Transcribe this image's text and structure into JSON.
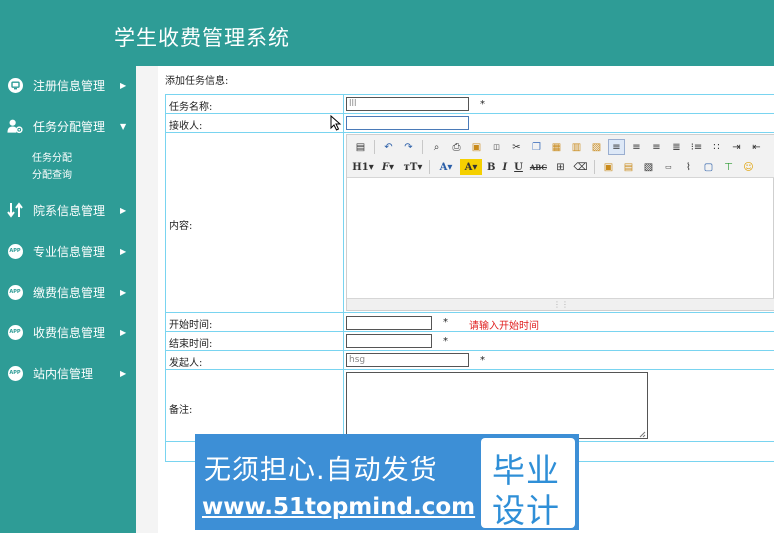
{
  "header": {
    "title": "学生收费管理系统"
  },
  "sidebar": {
    "items": [
      {
        "label": "注册信息管理",
        "icon": "monitor-icon"
      },
      {
        "label": "任务分配管理",
        "icon": "user-settings-icon",
        "expanded": true,
        "children": [
          {
            "label": "任务分配"
          },
          {
            "label": "分配查询"
          }
        ]
      },
      {
        "label": "院系信息管理",
        "icon": "swap-icon"
      },
      {
        "label": "专业信息管理",
        "icon": "app-icon",
        "badge": "APP"
      },
      {
        "label": "缴费信息管理",
        "icon": "app-icon",
        "badge": "APP"
      },
      {
        "label": "收费信息管理",
        "icon": "app-icon",
        "badge": "APP"
      },
      {
        "label": "站内信管理",
        "icon": "app-icon",
        "badge": "APP"
      }
    ]
  },
  "form": {
    "section_title": "添加任务信息:",
    "fields": {
      "task_name": {
        "label": "任务名称:",
        "value": "lll",
        "required": "*"
      },
      "receiver": {
        "label": "接收人:",
        "value": ""
      },
      "content": {
        "label": "内容:"
      },
      "start_time": {
        "label": "开始时间:",
        "value": "",
        "required": "*",
        "error": "请输入开始时间"
      },
      "end_time": {
        "label": "结束时间:",
        "value": "",
        "required": "*"
      },
      "sender": {
        "label": "发起人:",
        "value": "hsg",
        "required": "*"
      },
      "remark": {
        "label": "备注:",
        "value": ""
      }
    }
  },
  "editor": {
    "row1": [
      "source-icon",
      "undo-icon",
      "redo-icon",
      "preview-icon",
      "print-icon",
      "template-icon",
      "code-icon",
      "cut-icon",
      "copy-icon",
      "paste-icon",
      "paste-text-icon",
      "paste-word-icon",
      "align-left-icon",
      "align-center-icon",
      "align-right-icon",
      "justify-icon",
      "ordered-list-icon",
      "unordered-list-icon",
      "indent-icon",
      "outdent-icon"
    ],
    "row2_labels": {
      "heading": "H1",
      "font": "F",
      "size": "тT",
      "color": "A",
      "highlight": "A",
      "bold": "B",
      "italic": "I",
      "underline": "U",
      "strike": "ABC"
    },
    "resize_glyph": "⋮⋮"
  },
  "watermark": {
    "line1": "无须担心.自动发货",
    "line2": "www.51topmind.com",
    "badge_top": "毕业",
    "badge_bottom": "设计"
  }
}
